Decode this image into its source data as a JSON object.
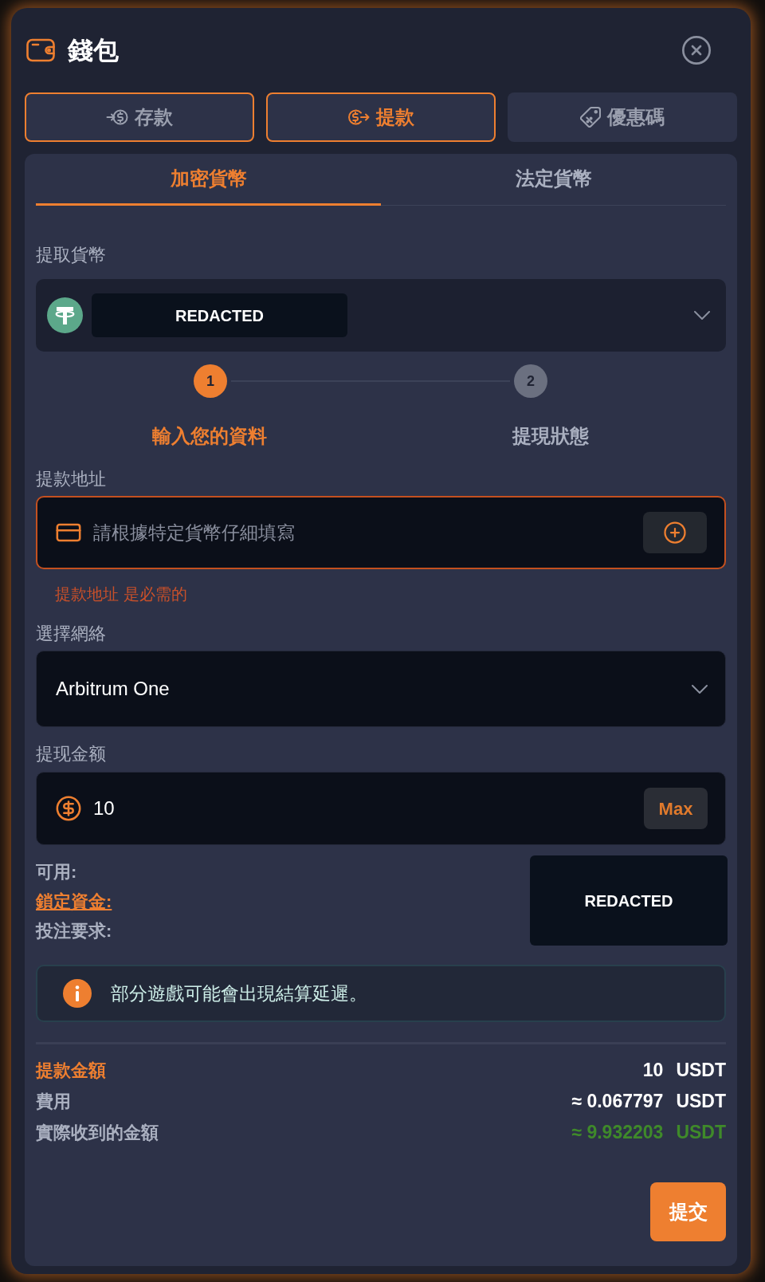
{
  "header": {
    "title": "錢包"
  },
  "tabs": [
    {
      "label": "存款",
      "selected": false,
      "outlined": true
    },
    {
      "label": "提款",
      "selected": true,
      "outlined": true
    },
    {
      "label": "優惠碼",
      "selected": false,
      "outlined": false
    }
  ],
  "subtabs": [
    {
      "label": "加密貨幣",
      "selected": true
    },
    {
      "label": "法定貨幣",
      "selected": false
    }
  ],
  "currency": {
    "label": "提取貨幣",
    "value": "REDACTED"
  },
  "steps": [
    {
      "number": "1",
      "label": "輸入您的資料",
      "selected": true
    },
    {
      "number": "2",
      "label": "提現狀態",
      "selected": false
    }
  ],
  "address": {
    "label": "提款地址",
    "placeholder": "請根據特定貨幣仔細填寫",
    "error": "提款地址 是必需的"
  },
  "network": {
    "label": "選擇網絡",
    "value": "Arbitrum One"
  },
  "amount": {
    "label": "提现金额",
    "value": "10",
    "max_button": "Max"
  },
  "balances": {
    "rows": [
      {
        "label": "可用:",
        "link": false
      },
      {
        "label": "鎖定資金:",
        "link": true
      },
      {
        "label": "投注要求:",
        "link": false
      }
    ],
    "values": "REDACTED"
  },
  "notice": "部分遊戲可能會出現結算延遲。",
  "summary": [
    {
      "kind": "total",
      "label": "提款金額",
      "value": "10",
      "unit": "USDT"
    },
    {
      "kind": "fee",
      "label": "費用",
      "value": "≈ 0.067797",
      "unit": "USDT"
    },
    {
      "kind": "received",
      "label": "實際收到的金額",
      "value": "≈ 9.932203",
      "unit": "USDT"
    }
  ],
  "submit": "提交"
}
